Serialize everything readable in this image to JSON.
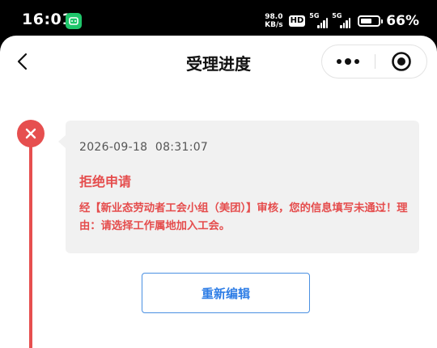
{
  "status_bar": {
    "time": "16:01",
    "app_icon": "wechat-like-app-icon",
    "net_speed_value": "98.0",
    "net_speed_unit": "KB/s",
    "hd_badge": "HD",
    "signal_1_label": "5G",
    "signal_2_label": "5G",
    "battery_percent": "66%",
    "battery_level": 0.66
  },
  "nav": {
    "title": "受理进度",
    "back_icon": "chevron-left-icon",
    "more_icon": "more-dots-icon",
    "close_icon": "target-circle-icon"
  },
  "timeline": {
    "status_icon": "close-icon",
    "color": "#e64f4f"
  },
  "card": {
    "timestamp": "2026-09-18  08:31:07",
    "status": "拒绝申请",
    "message": "经【新业态劳动者工会小组（美团）】审核，您的信息填写未通过！理由：请选择工作属地加入工会。"
  },
  "actions": {
    "reedit_label": "重新编辑",
    "accent": "#2f7ee6"
  }
}
